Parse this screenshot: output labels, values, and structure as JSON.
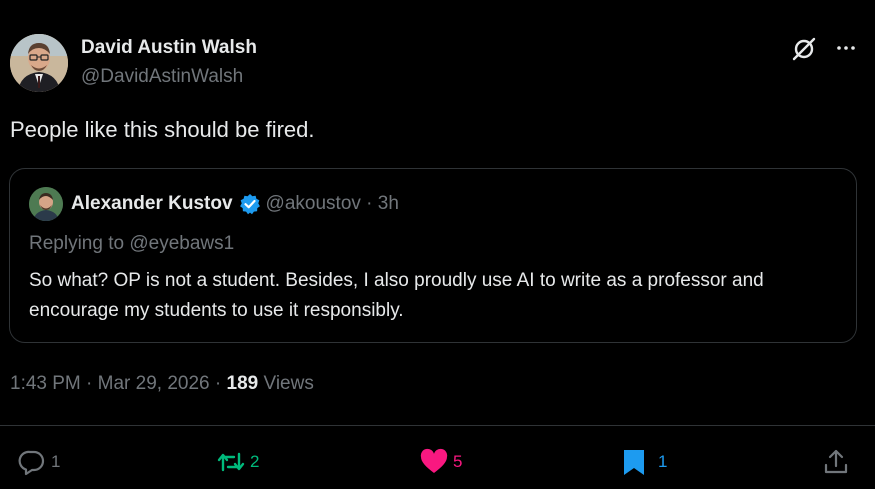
{
  "author": {
    "name": "David Austin Walsh",
    "handle": "@DavidAstinWalsh"
  },
  "tweet": {
    "text": "People like this should be fired."
  },
  "quote": {
    "name": "Alexander Kustov",
    "handle": "@akoustov",
    "separator": "·",
    "time": "3h",
    "reply_prefix": "Replying to",
    "reply_to": "@eyebaws1",
    "text": "So what? OP is not a student. Besides, I also proudly use AI to write as a professor and encourage my students to use it responsibly."
  },
  "meta": {
    "time": "1:43 PM",
    "date": "Mar 29, 2026",
    "views_count": "189",
    "views_label": "Views"
  },
  "actions": {
    "replies": "1",
    "reposts": "2",
    "likes": "5",
    "bookmarks": "1"
  },
  "colors": {
    "background": "#000000",
    "text": "#e7e9ea",
    "muted": "#71767b",
    "border": "#2f3336",
    "repost": "#00ba7c",
    "like": "#f91880",
    "bookmark": "#1d9bf0",
    "verified": "#1d9bf0"
  },
  "icons": [
    "grok-icon",
    "more-icon",
    "verified-badge-icon",
    "reply-icon",
    "repost-icon",
    "heart-icon",
    "bookmark-icon",
    "share-icon"
  ]
}
